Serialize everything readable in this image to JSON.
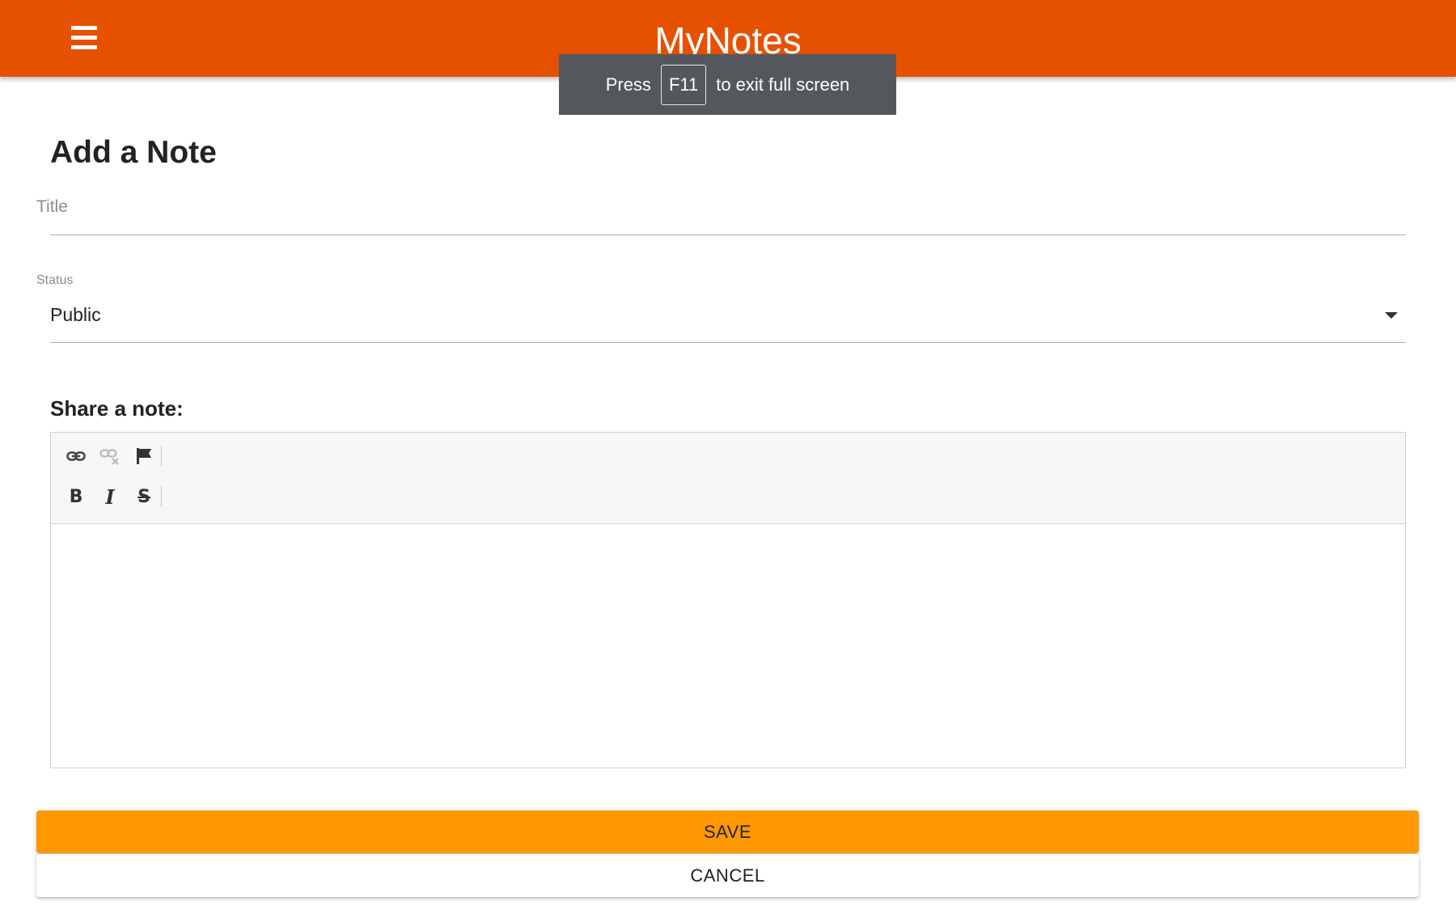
{
  "app": {
    "title": "MyNotes",
    "accent_color": "#e65100",
    "menu_icon": "hamburger-menu-icon"
  },
  "fullscreen_toast": {
    "prefix": "Press",
    "key": "F11",
    "suffix": "to exit full screen"
  },
  "form": {
    "heading": "Add a Note",
    "title_field": {
      "label": "Title",
      "value": ""
    },
    "status_field": {
      "label": "Status",
      "selected": "Public"
    },
    "share_label": "Share a note:",
    "editor": {
      "toolbar_row1": [
        "link-icon",
        "unlink-icon",
        "flag-icon"
      ],
      "toolbar_row2": [
        "bold-icon",
        "italic-icon",
        "strikethrough-icon"
      ],
      "bold_glyph": "B",
      "italic_glyph": "I",
      "strike_glyph": "S",
      "content": ""
    }
  },
  "actions": {
    "save_label": "SAVE",
    "cancel_label": "CANCEL",
    "save_color": "#ff9800"
  }
}
